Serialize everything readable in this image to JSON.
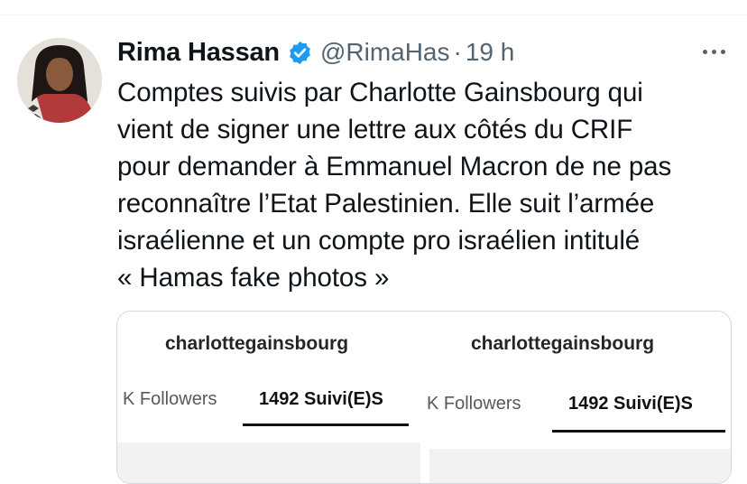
{
  "tweet": {
    "author_name": "Rima Hassan",
    "handle": "@RimaHas",
    "separator": "·",
    "time": "19 h",
    "text": "Comptes suivis par Charlotte Gainsbourg qui\nvient de signer une lettre aux côtés du CRIF\npour demander à Emmanuel Macron de ne pas\nreconnaître l’Etat Palestinien. Elle suit l’armée\nisraélienne et un compte pro israélien intitulé\n« Hamas fake photos »"
  },
  "media": {
    "left_screenshot": {
      "username": "charlottegainsbourg",
      "followers_label": "K Followers",
      "following_label": "1492 Suivi(E)S"
    },
    "right_screenshot": {
      "username": "charlottegainsbourg",
      "followers_label": "K Followers",
      "following_label": "1492 Suivi(E)S"
    }
  },
  "colors": {
    "verified_badge": "#1d9bf0",
    "secondary_text": "#536471",
    "border": "#cfd9de"
  },
  "icons": {
    "verified": "verified-badge-icon",
    "more": "more-options-icon"
  }
}
